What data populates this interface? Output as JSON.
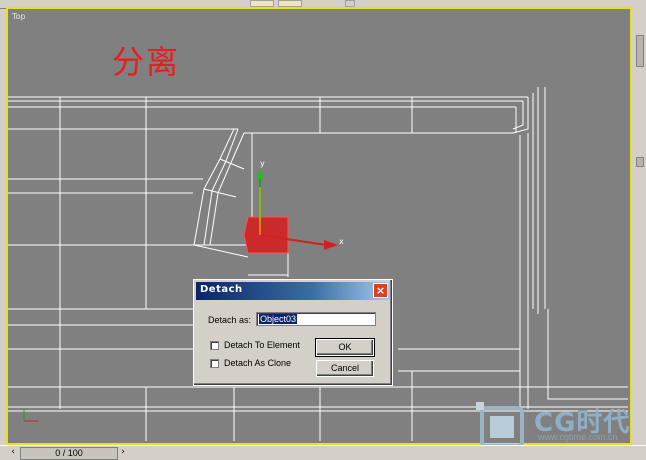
{
  "viewport": {
    "label": "Top",
    "watermark_title": "分离",
    "border_color": "#e8e020",
    "bg_color": "#808080"
  },
  "axes": {
    "y_label": "y",
    "x_label": "x"
  },
  "dialog": {
    "title": "Detach",
    "close_label": "X",
    "detach_as_label": "Detach as:",
    "detach_as_value": "Object03",
    "to_element_label": "Detach To Element",
    "as_clone_label": "Detach As Clone",
    "to_element_checked": false,
    "as_clone_checked": false,
    "ok_label": "OK",
    "cancel_label": "Cancel"
  },
  "timeline": {
    "position_text": "0 / 100",
    "prev_icon": "chevron-left-icon",
    "next_icon": "chevron-right-icon"
  },
  "logo": {
    "brand": "CG时代",
    "url": "www.cgtime.com.cn"
  }
}
